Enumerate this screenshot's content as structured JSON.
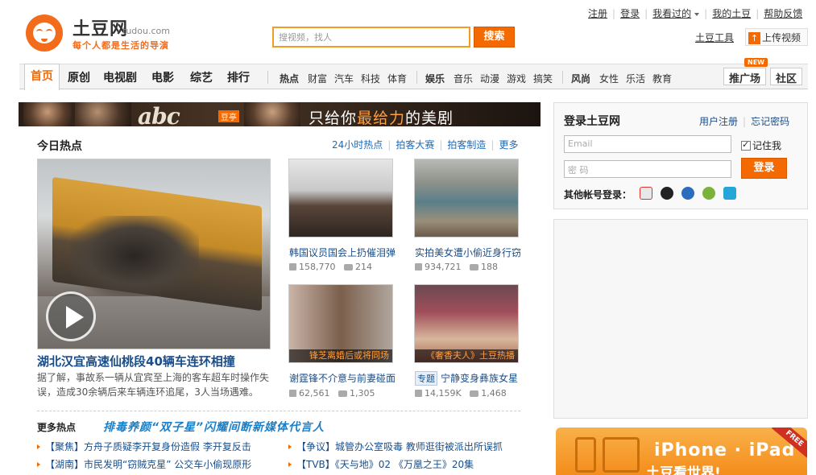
{
  "logo": {
    "title": "土豆网",
    "domain": "tudou.com",
    "slogan": "每个人都是生活的导演"
  },
  "search": {
    "placeholder": "搜视频，找人",
    "button": "搜索"
  },
  "top_links": [
    "注册",
    "登录",
    "我看过的",
    "我的土豆",
    "帮助反馈"
  ],
  "tools": {
    "tools_link": "土豆工具",
    "upload": "上传视频"
  },
  "nav": {
    "home": "首页",
    "main": [
      "原创",
      "电视剧",
      "电影",
      "综艺",
      "排行"
    ],
    "group1": [
      "热点",
      "财富",
      "汽车",
      "科技",
      "体育"
    ],
    "group2": [
      "娱乐",
      "音乐",
      "动漫",
      "游戏",
      "搞笑"
    ],
    "group3": [
      "风尚",
      "女性",
      "乐活",
      "教育"
    ],
    "right": [
      "推广场",
      "社区"
    ],
    "new_badge": "NEW"
  },
  "banner": {
    "brand": "abc",
    "tag": "豆亭",
    "slogan_a": "只给你",
    "slogan_b": "最给力",
    "slogan_c": "的美剧"
  },
  "hot": {
    "title": "今日热点",
    "tabs": [
      "24小时热点",
      "拍客大赛",
      "拍客制造",
      "更多"
    ],
    "main": {
      "headline": "湖北汉宜高速仙桃段40辆车连环相撞",
      "desc": "据了解，事故系一辆从宜宾至上海的客车超车时操作失误，造成30余辆后来车辆连环追尾，3人当场遇难。"
    },
    "videos": [
      {
        "title": "韩国议员国会上扔催泪弹",
        "views": "158,770",
        "comments": "214",
        "caption": ""
      },
      {
        "title": "实拍美女遭小偷近身行窃",
        "views": "934,721",
        "comments": "188",
        "caption": ""
      },
      {
        "title": "谢霆锋不介意与前妻碰面",
        "views": "62,561",
        "comments": "1,305",
        "caption": "锋芝离婚后或将同场"
      },
      {
        "title": "宁静变身彝族女星",
        "topic": "专题",
        "views": "14,159K",
        "comments": "1,468",
        "caption": "《奢香夫人》土豆热播"
      }
    ]
  },
  "more_hot": {
    "title": "更多热点",
    "promo": "排毒养颜“双子星”闪耀间断新媒体代言人",
    "items": [
      "【聚焦】方舟子质疑李开复身份造假 李开复反击",
      "【争议】城管办公室吸毒  教师逛街被派出所误抓",
      "【湖南】市民发明“窃贼克星” 公交车小偷现原形",
      "【TVB】《天与地》02  《万凰之王》20集"
    ]
  },
  "login": {
    "title": "登录土豆网",
    "register": "用户注册",
    "forgot": "忘记密码",
    "email_placeholder": "Email",
    "password_placeholder": "密 码",
    "remember": "记住我",
    "button": "登录",
    "other": "其他帐号登录："
  },
  "iphone_ad": {
    "line1": "iPhone · iPad",
    "line2": "土豆看世界!",
    "free": "FREE"
  }
}
